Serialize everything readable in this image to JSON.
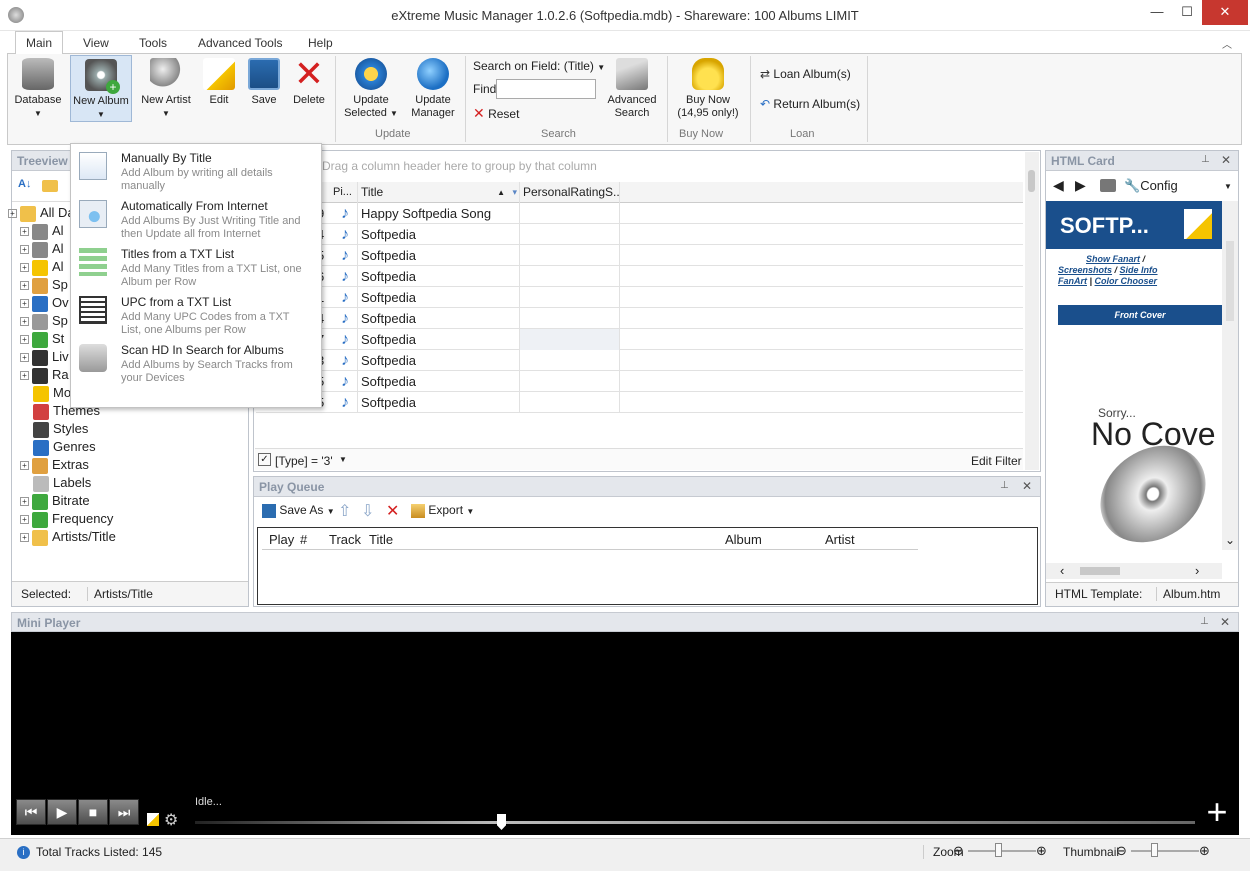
{
  "window": {
    "title": "eXtreme Music Manager 1.0.2.6 (Softpedia.mdb) - Shareware: 100 Albums LIMIT",
    "minimize": "—",
    "maximize": "☐",
    "close": "✕"
  },
  "tabs": [
    "Main",
    "View",
    "Tools",
    "Advanced Tools",
    "Help"
  ],
  "ribbon": {
    "database": "Database",
    "new_album": "New Album",
    "new_artist": "New Artist",
    "edit": "Edit",
    "save": "Save",
    "delete": "Delete",
    "update_selected": "Update Selected",
    "update_manager": "Update Manager",
    "group_update": "Update",
    "search_on_field": "Search on Field: (Title)",
    "find": "Find",
    "find_value": "",
    "reset": "Reset",
    "advanced_search": "Advanced Search",
    "group_search": "Search",
    "buy_now": "Buy Now (14,95 only!)",
    "group_buy": "Buy Now",
    "loan_albums": "Loan Album(s)",
    "return_albums": "Return Album(s)",
    "group_loan": "Loan"
  },
  "treeview": {
    "title": "Treeview",
    "items": [
      "All Da",
      "Al",
      "Al",
      "Al",
      "Sp",
      "Ov",
      "Sp",
      "St",
      "Liv",
      "Ra",
      "Mo",
      "Themes",
      "Styles",
      "Genres",
      "Extras",
      "Labels",
      "Bitrate",
      "Frequency",
      "Artists/Title"
    ],
    "selected_label": "Selected:",
    "selected_value": "Artists/Title"
  },
  "grid": {
    "group_hint": "Drag a column header here to group by that column",
    "headers": {
      "pi": "Pi...",
      "title": "Title",
      "rating": "PersonalRatingS..."
    },
    "rows": [
      {
        "num": "9",
        "title": "Happy Softpedia Song"
      },
      {
        "num": "4",
        "title": "Softpedia"
      },
      {
        "num": "5",
        "title": "Softpedia"
      },
      {
        "num": "6",
        "title": "Softpedia"
      },
      {
        "num": "1",
        "title": "Softpedia"
      },
      {
        "num": "4",
        "title": "Softpedia"
      },
      {
        "num": "7",
        "title": "Softpedia"
      },
      {
        "num": "3",
        "title": "Softpedia"
      },
      {
        "num": "5",
        "title": "Softpedia"
      },
      {
        "num": "5",
        "title": "Softpedia"
      }
    ],
    "filter": "[Type] = '3'",
    "edit_filter": "Edit Filter"
  },
  "menu": [
    {
      "title": "Manually By Title",
      "desc": "Add Album by writing all details manually"
    },
    {
      "title": "Automatically From Internet",
      "desc": "Add Albums By Just Writing Title and then Update all from Internet"
    },
    {
      "title": "Titles from a TXT List",
      "desc": "Add Many Titles from a TXT List, one Album per Row"
    },
    {
      "title": "UPC from a TXT List",
      "desc": "Add Many UPC Codes from a TXT List, one Albums per Row"
    },
    {
      "title": "Scan HD In Search for Albums",
      "desc": "Add Albums by Search Tracks from your Devices"
    }
  ],
  "play_queue": {
    "title": "Play Queue",
    "save_as": "Save As",
    "export": "Export",
    "headers": [
      "Play",
      "#",
      "Track",
      "Title",
      "Album",
      "Artist"
    ]
  },
  "html_card": {
    "title": "HTML Card",
    "config": "Config",
    "logo": "SOFTP...",
    "links": {
      "show_fanart": "Show Fanart",
      "screenshots": "Screenshots",
      "side_info": "Side Info",
      "fanart": "FanArt",
      "color_chooser": "Color Chooser"
    },
    "front_cover": "Front Cover",
    "sorry": "Sorry...",
    "no_cover": "No Cove",
    "template_label": "HTML Template:",
    "template_value": "Album.htm"
  },
  "mini_player": {
    "title": "Mini Player",
    "status": "Idle..."
  },
  "status": {
    "total": "Total Tracks Listed: 145",
    "zoom": "Zoom",
    "thumbnail": "Thumbnail"
  },
  "colors": {
    "accent": "#1e5a9a",
    "close": "#c7372f",
    "header_text": "#8a95a5"
  }
}
